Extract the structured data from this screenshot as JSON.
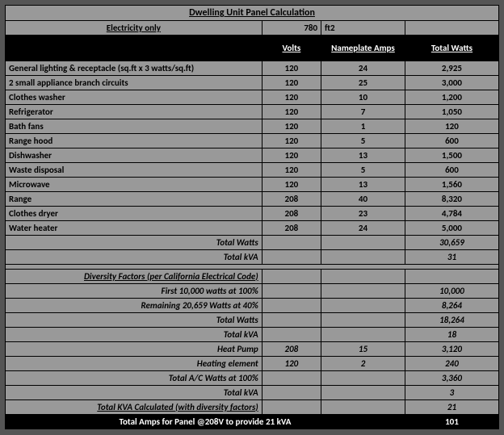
{
  "title": "Dwelling Unit Panel Calculation",
  "subtitle": "Electricity only",
  "sqft_value": "780",
  "sqft_unit": "ft2",
  "headers": {
    "volts": "Volts",
    "amps": "Nameplate Amps",
    "watts": "Total Watts"
  },
  "rows": [
    {
      "label": "General lighting & receptacle (sq.ft x 3 watts/sq.ft)",
      "volts": "120",
      "amps": "24",
      "watts": "2,925"
    },
    {
      "label": "2 small appliance branch circuits",
      "volts": "120",
      "amps": "25",
      "watts": "3,000"
    },
    {
      "label": "Clothes washer",
      "volts": "120",
      "amps": "10",
      "watts": "1,200"
    },
    {
      "label": "Refrigerator",
      "volts": "120",
      "amps": "7",
      "watts": "1,050"
    },
    {
      "label": "Bath fans",
      "volts": "120",
      "amps": "1",
      "watts": "120"
    },
    {
      "label": "Range hood",
      "volts": "120",
      "amps": "5",
      "watts": "600"
    },
    {
      "label": "Dishwasher",
      "volts": "120",
      "amps": "13",
      "watts": "1,500"
    },
    {
      "label": "Waste disposal",
      "volts": "120",
      "amps": "5",
      "watts": "600"
    },
    {
      "label": "Microwave",
      "volts": "120",
      "amps": "13",
      "watts": "1,560"
    },
    {
      "label": "Range",
      "volts": "208",
      "amps": "40",
      "watts": "8,320"
    },
    {
      "label": "Clothes dryer",
      "volts": "208",
      "amps": "23",
      "watts": "4,784"
    },
    {
      "label": "Water heater",
      "volts": "208",
      "amps": "24",
      "watts": "5,000"
    }
  ],
  "totals1": {
    "watts_label": "Total Watts",
    "watts_value": "30,659",
    "kva_label": "Total kVA",
    "kva_value": "31"
  },
  "diversity": {
    "header": "Diversity Factors (per California Electrical Code)",
    "r1": {
      "label": "First 10,000 watts at 100%",
      "value": "10,000"
    },
    "r2": {
      "label": "Remaining 20,659 Watts at 40%",
      "value": "8,264"
    },
    "r3": {
      "label": "Total Watts",
      "value": "18,264"
    },
    "r4": {
      "label": "Total kVA",
      "value": "18"
    }
  },
  "hvac": {
    "hp": {
      "label": "Heat Pump",
      "volts": "208",
      "amps": "15",
      "watts": "3,120"
    },
    "heat": {
      "label": "Heating element",
      "volts": "120",
      "amps": "2",
      "watts": "240"
    },
    "ac": {
      "label": "Total A/C Watts at 100%",
      "value": "3,360"
    },
    "kva": {
      "label": "Total kVA",
      "value": "3"
    }
  },
  "calc_total": {
    "label": "Total KVA Calculated (with diversity factors)",
    "value": "21"
  },
  "final": {
    "label": "Total Amps for Panel @208V to provide 21 kVA",
    "value": "101"
  },
  "chart_data": {
    "type": "table",
    "title": "Dwelling Unit Panel Calculation",
    "subtitle": "Electricity only — 780 ft2",
    "columns": [
      "Item",
      "Volts",
      "Nameplate Amps",
      "Total Watts"
    ],
    "data": [
      [
        "General lighting & receptacle (sq.ft x 3 watts/sq.ft)",
        120,
        24,
        2925
      ],
      [
        "2 small appliance branch circuits",
        120,
        25,
        3000
      ],
      [
        "Clothes washer",
        120,
        10,
        1200
      ],
      [
        "Refrigerator",
        120,
        7,
        1050
      ],
      [
        "Bath fans",
        120,
        1,
        120
      ],
      [
        "Range hood",
        120,
        5,
        600
      ],
      [
        "Dishwasher",
        120,
        13,
        1500
      ],
      [
        "Waste disposal",
        120,
        5,
        600
      ],
      [
        "Microwave",
        120,
        13,
        1560
      ],
      [
        "Range",
        208,
        40,
        8320
      ],
      [
        "Clothes dryer",
        208,
        23,
        4784
      ],
      [
        "Water heater",
        208,
        24,
        5000
      ]
    ],
    "subtotals": {
      "Total Watts": 30659,
      "Total kVA": 31
    },
    "diversity": {
      "First 10,000 watts at 100%": 10000,
      "Remaining 20,659 Watts at 40%": 8264,
      "Total Watts": 18264,
      "Total kVA": 18
    },
    "hvac": {
      "Heat Pump": {
        "volts": 208,
        "amps": 15,
        "watts": 3120
      },
      "Heating element": {
        "volts": 120,
        "amps": 2,
        "watts": 240
      },
      "Total A/C Watts at 100%": 3360,
      "Total kVA": 3
    },
    "final": {
      "Total KVA Calculated (with diversity factors)": 21,
      "Total Amps for Panel @208V to provide 21 kVA": 101
    }
  }
}
